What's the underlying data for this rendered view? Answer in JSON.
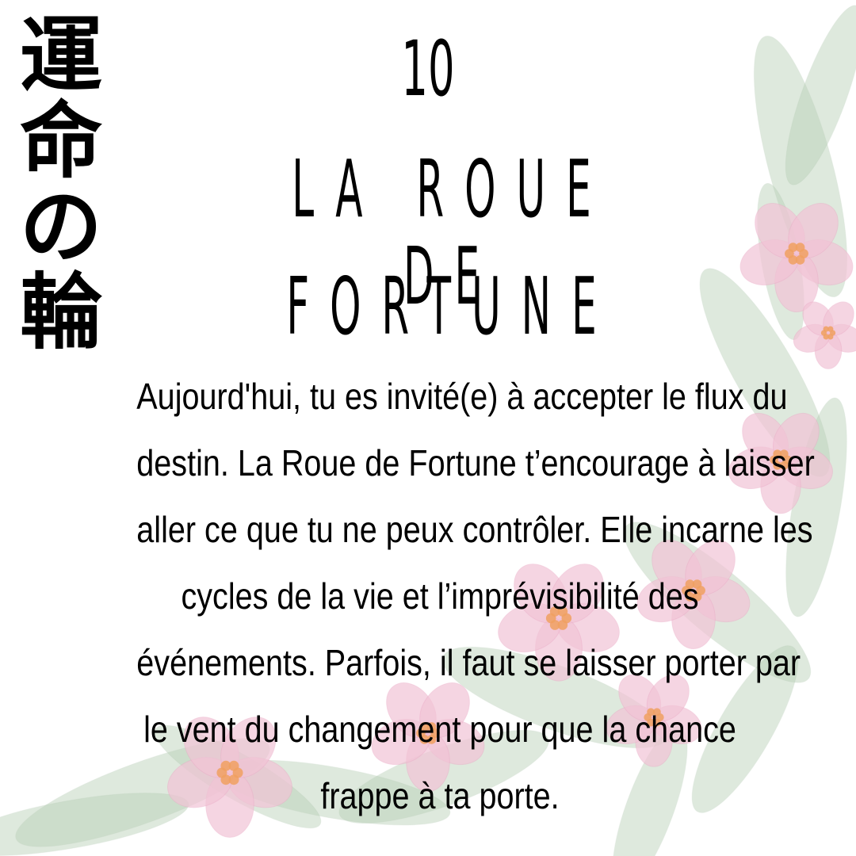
{
  "card": {
    "vertical_title": [
      "運",
      "命",
      "の",
      "輪"
    ],
    "number": "10",
    "title_lines": [
      "LA ROUE DE",
      "FORTUNE"
    ],
    "body_lines": [
      "Aujourd'hui, tu es invité(e) à accepter le flux du",
      "destin. La Roue de Fortune t’encourage à laisser",
      "aller ce que tu ne peux contrôler. Elle incarne les",
      "cycles de la vie et l’imprévisibilité des",
      "événements. Parfois, il faut se laisser porter par",
      "le vent du changement pour que la chance",
      "frappe à ta porte."
    ]
  },
  "colors": {
    "petal": "#f2c4d6",
    "petal_edge": "#e9a8c4",
    "flower_center": "#f0a060",
    "leaf": "#b8cfb6",
    "leaf_dark": "#9bb89a"
  }
}
